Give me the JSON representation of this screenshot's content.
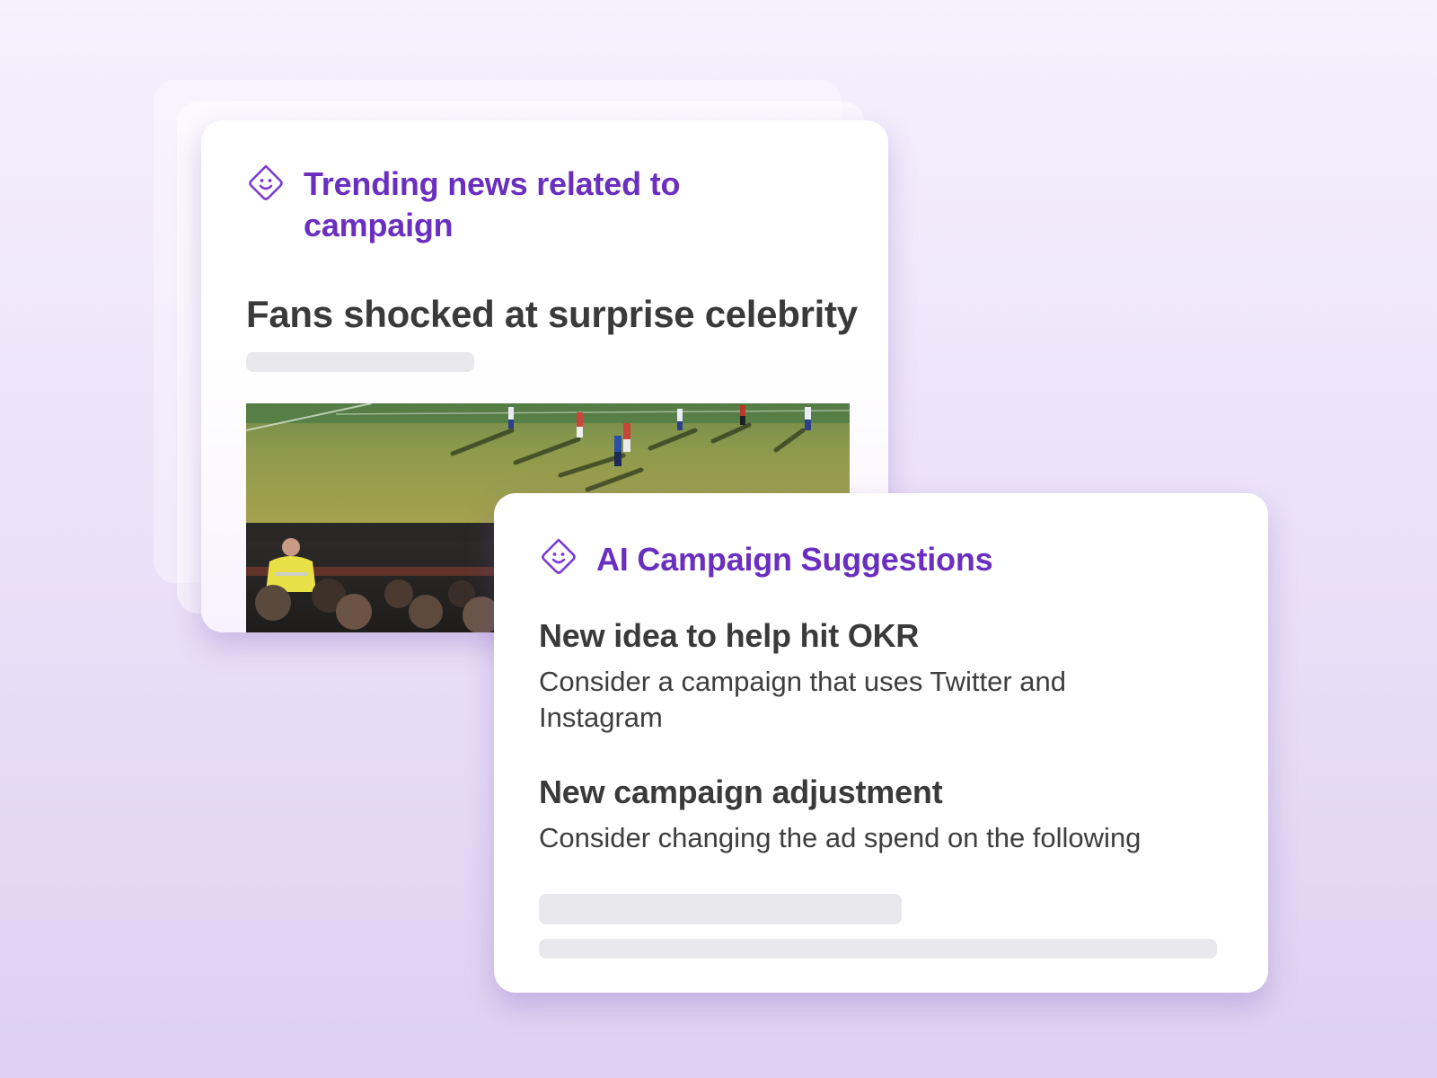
{
  "trending": {
    "title": "Trending news related to campaign",
    "icon": "smile-diamond-icon",
    "headline": "Fans shocked at surprise celebrity",
    "image": "soccer-match-photo"
  },
  "suggestions": {
    "title": "AI Campaign Suggestions",
    "icon": "smile-diamond-icon",
    "items": [
      {
        "title": "New idea to help hit OKR",
        "description": "Consider a campaign that uses Twitter and Instagram"
      },
      {
        "title": "New campaign adjustment",
        "description": "Consider changing the ad spend on the following"
      }
    ]
  },
  "colors": {
    "accent": "#6a2fc0",
    "text": "#3a3a3a",
    "skeleton": "#e9e8ec"
  }
}
